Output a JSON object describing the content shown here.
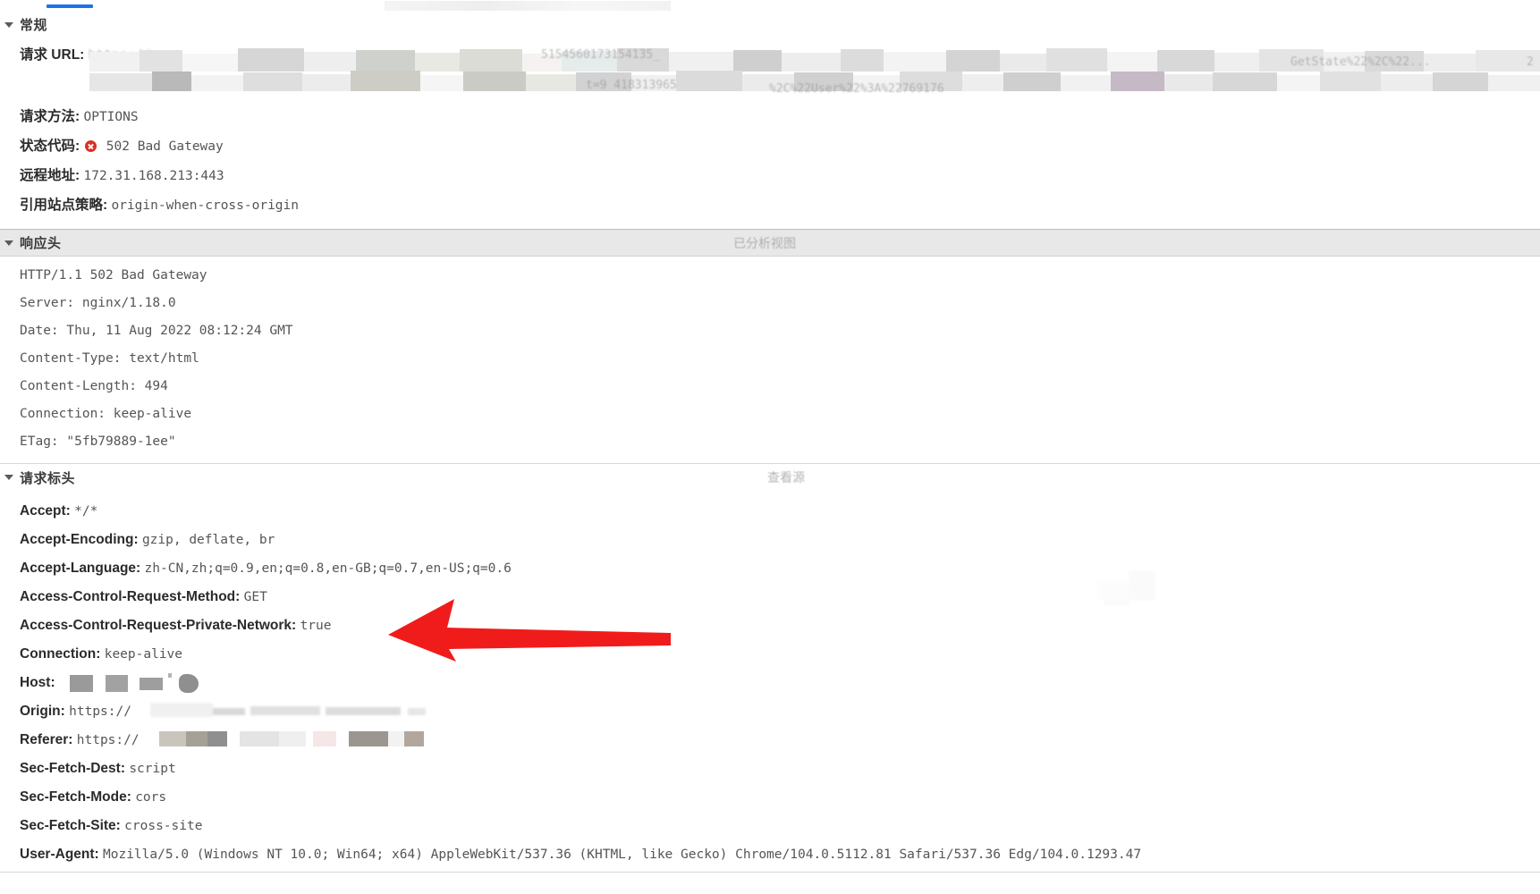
{
  "window": {
    "active_tab_indicator": "headers-tab"
  },
  "sections": [
    {
      "id": "general",
      "title": "常规",
      "expanded": true,
      "action": "",
      "rows": [
        {
          "key": "请求 URL:",
          "value": "https://",
          "redacted": true
        },
        {
          "key": "请求方法:",
          "value": "OPTIONS",
          "redacted": false
        },
        {
          "key": "状态代码:",
          "value": "502 Bad Gateway",
          "status": "error",
          "redacted": false
        },
        {
          "key": "远程地址:",
          "value": "172.31.168.213:443",
          "redacted": false
        },
        {
          "key": "引用站点策略:",
          "value": "origin-when-cross-origin",
          "redacted": false
        }
      ]
    },
    {
      "id": "response-headers",
      "title": "响应头",
      "expanded": true,
      "action": "已分析视图",
      "raw_lines": [
        "HTTP/1.1 502 Bad Gateway",
        "Server: nginx/1.18.0",
        "Date: Thu, 11 Aug 2022 08:12:24 GMT",
        "Content-Type: text/html",
        "Content-Length: 494",
        "Connection: keep-alive",
        "ETag: \"5fb79889-1ee\""
      ]
    },
    {
      "id": "request-headers",
      "title": "请求标头",
      "expanded": true,
      "action": "查看源",
      "rows": [
        {
          "key": "Accept:",
          "value": "*/*",
          "redacted": false
        },
        {
          "key": "Accept-Encoding:",
          "value": "gzip, deflate, br",
          "redacted": false
        },
        {
          "key": "Accept-Language:",
          "value": "zh-CN,zh;q=0.9,en;q=0.8,en-GB;q=0.7,en-US;q=0.6",
          "redacted": false
        },
        {
          "key": "Access-Control-Request-Method:",
          "value": "GET",
          "redacted": false
        },
        {
          "key": "Access-Control-Request-Private-Network:",
          "value": "true",
          "redacted": false,
          "highlighted": true
        },
        {
          "key": "Connection:",
          "value": "keep-alive",
          "redacted": false
        },
        {
          "key": "Host:",
          "value": "",
          "redacted": true
        },
        {
          "key": "Origin:",
          "value": "https://",
          "redacted": true
        },
        {
          "key": "Referer:",
          "value": "https://",
          "redacted": true
        },
        {
          "key": "Sec-Fetch-Dest:",
          "value": "script",
          "redacted": false
        },
        {
          "key": "Sec-Fetch-Mode:",
          "value": "cors",
          "redacted": false
        },
        {
          "key": "Sec-Fetch-Site:",
          "value": "cross-site",
          "redacted": false
        },
        {
          "key": "User-Agent:",
          "value": "Mozilla/5.0 (Windows NT 10.0; Win64; x64) AppleWebKit/537.36 (KHTML, like Gecko) Chrome/104.0.5112.81 Safari/537.36 Edg/104.0.1293.47",
          "redacted": false
        }
      ]
    }
  ],
  "url_fragments": {
    "scheme": "https:",
    "visible_a": "5154560173154135_",
    "visible_b": "t=9 418313965",
    "visible_c": "%2C%22User%22%3A%22769176",
    "visible_d": "GetState%22%2C%22...",
    "visible_e": "2"
  },
  "annotation": {
    "type": "arrow",
    "color": "#f01c1c",
    "direction": "left",
    "points_at": "Access-Control-Request-Private-Network"
  },
  "colors": {
    "accent": "#1a73e8",
    "error": "#d93025",
    "annotation": "#f01c1c",
    "section_bar": "#e8e8e8",
    "text": "#303030",
    "value_text": "#555555"
  }
}
